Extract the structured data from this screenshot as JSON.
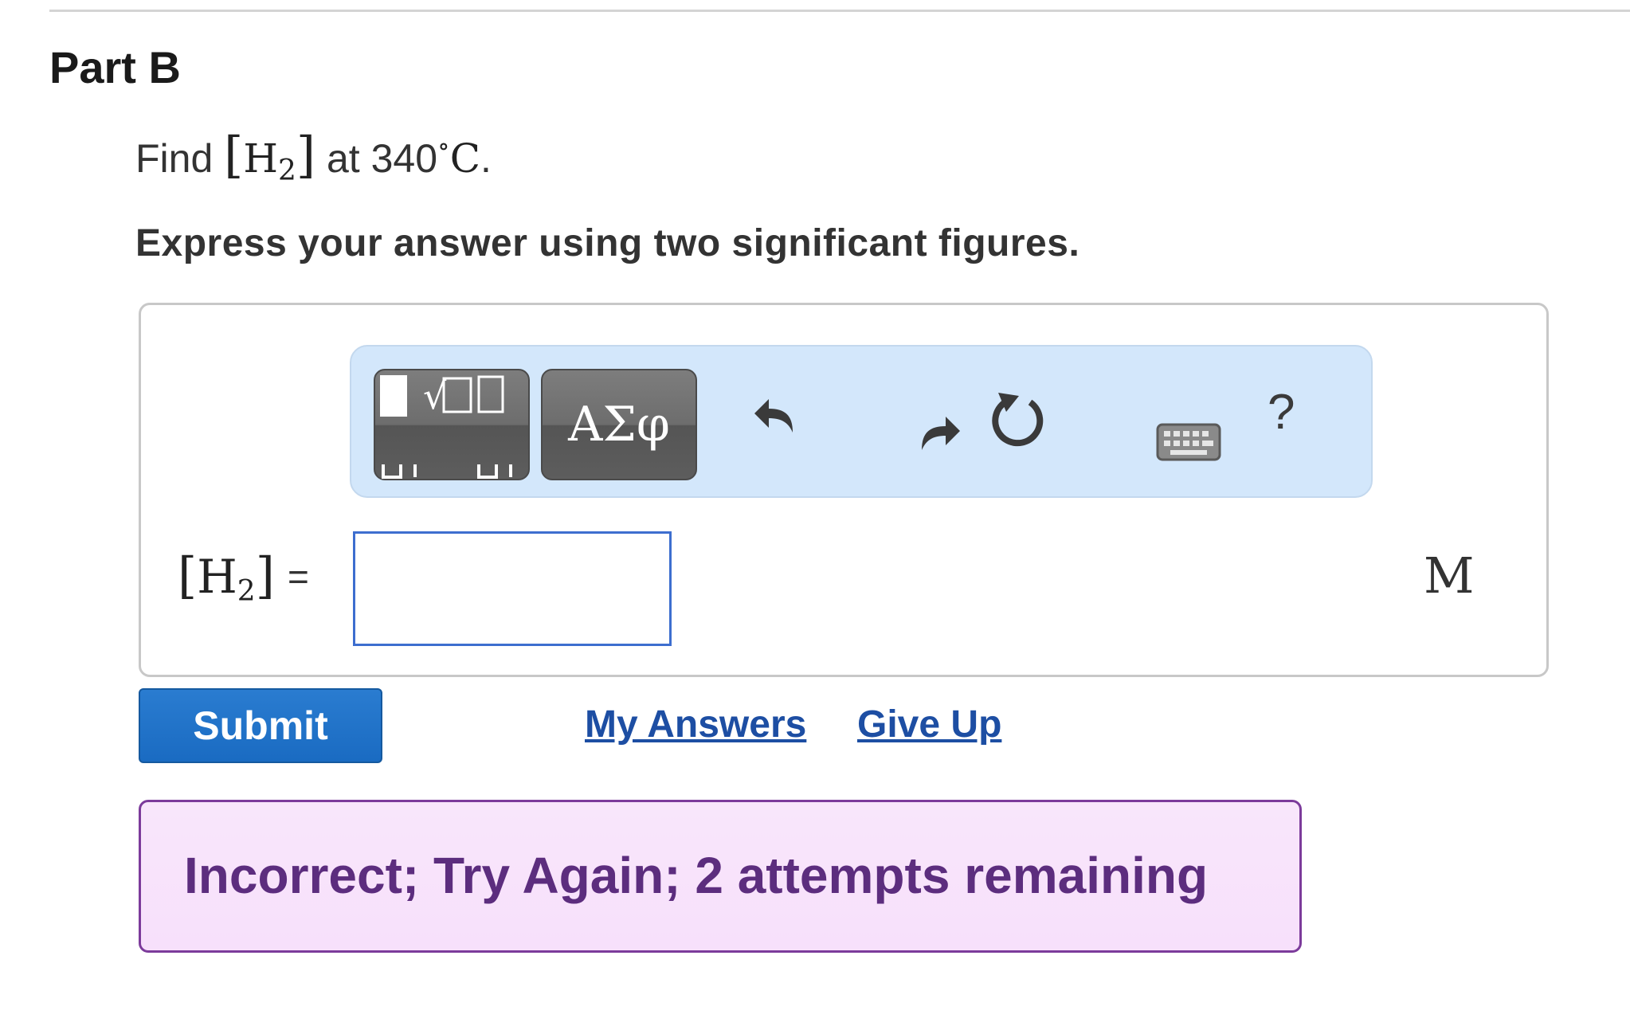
{
  "part": {
    "title": "Part B"
  },
  "question": {
    "prefix": "Find",
    "species_symbol": "H",
    "species_subscript": "2",
    "middle": "at 340",
    "degree": "∘",
    "unit_celsius": "C",
    "suffix": "."
  },
  "instruction": "Express your answer using two significant figures.",
  "toolbar": {
    "templates_icon": "templates-icon",
    "greek_label": "ΑΣφ",
    "undo_icon": "undo-icon",
    "redo_icon": "redo-icon",
    "reset_icon": "reset-icon",
    "keyboard_icon": "keyboard-icon",
    "help_label": "?"
  },
  "answer": {
    "label_symbol": "H",
    "label_subscript": "2",
    "equals": "=",
    "value": "",
    "unit": "M"
  },
  "actions": {
    "submit_label": "Submit",
    "my_answers_label": "My Answers",
    "give_up_label": "Give Up"
  },
  "feedback": {
    "text": "Incorrect; Try Again; 2 attempts remaining"
  },
  "colors": {
    "submit": "#1a6bc2",
    "link": "#1d4ea3",
    "feedback_border": "#7c3b9b",
    "feedback_bg": "#f8e6fb",
    "feedback_text": "#5c2d7e",
    "toolbar_bg": "#d3e7fb",
    "input_border": "#3d6ecf"
  }
}
